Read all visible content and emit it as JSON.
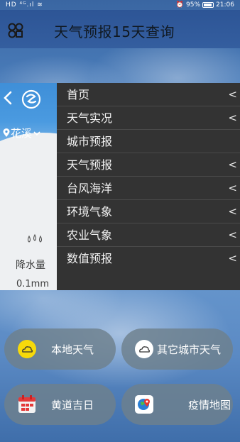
{
  "status_bar": {
    "left": "HD ⁴ᴳ.ıl ≋",
    "battery": "95%",
    "battery_level": 0.95,
    "time": "21:06"
  },
  "app": {
    "title": "天气预报15天查询"
  },
  "weather_card": {
    "city": "花溪",
    "rain_label": "降水量",
    "rain_value": "0.1mm"
  },
  "menu": {
    "items": [
      {
        "label": "首页",
        "chevron": "<"
      },
      {
        "label": "天气实况",
        "chevron": "<"
      },
      {
        "label": "城市预报",
        "chevron": ""
      },
      {
        "label": "天气预报",
        "chevron": "<"
      },
      {
        "label": "台风海洋",
        "chevron": "<"
      },
      {
        "label": "环境气象",
        "chevron": "<"
      },
      {
        "label": "农业气象",
        "chevron": "<"
      },
      {
        "label": "数值预报",
        "chevron": "<"
      }
    ]
  },
  "buttons": {
    "local_weather": {
      "label": "本地天气",
      "icon": "cloud-yellow-icon"
    },
    "other_cities": {
      "label": "其它城市天气",
      "icon": "cloud-white-icon"
    },
    "almanac": {
      "label": "黄道吉日",
      "icon": "calendar-icon"
    },
    "epidemic_map": {
      "label": "疫情地图",
      "icon": "globe-pin-icon"
    }
  },
  "colors": {
    "title_bar": "#2d5596",
    "menu_bg": "#333333",
    "card_header": "#4a9ae0",
    "button_bg": "#6e808c"
  }
}
